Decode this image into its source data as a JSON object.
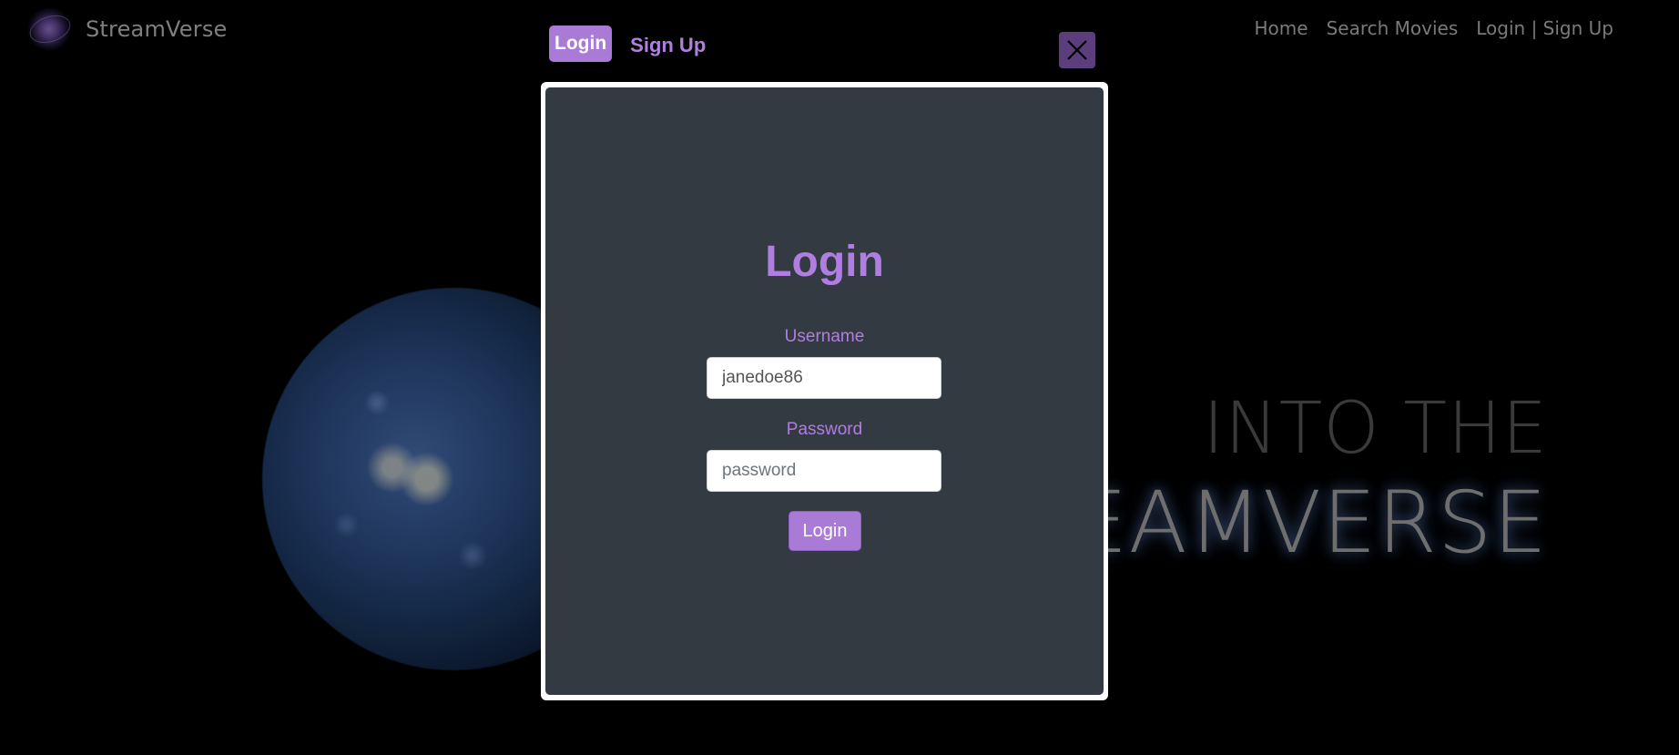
{
  "navbar": {
    "brand": "StreamVerse",
    "links": [
      "Home",
      "Search Movies",
      "Login | Sign Up"
    ]
  },
  "hero": {
    "line1": "INTO THE",
    "line2": "REAMVERSE"
  },
  "modal": {
    "tabs": {
      "login": "Login",
      "signup": "Sign Up"
    },
    "heading": "Login",
    "username_label": "Username",
    "username_value": "janedoe86",
    "password_label": "Password",
    "password_placeholder": "password",
    "submit_label": "Login"
  },
  "colors": {
    "accent": "#a97bd6",
    "panel": "#343a42"
  }
}
